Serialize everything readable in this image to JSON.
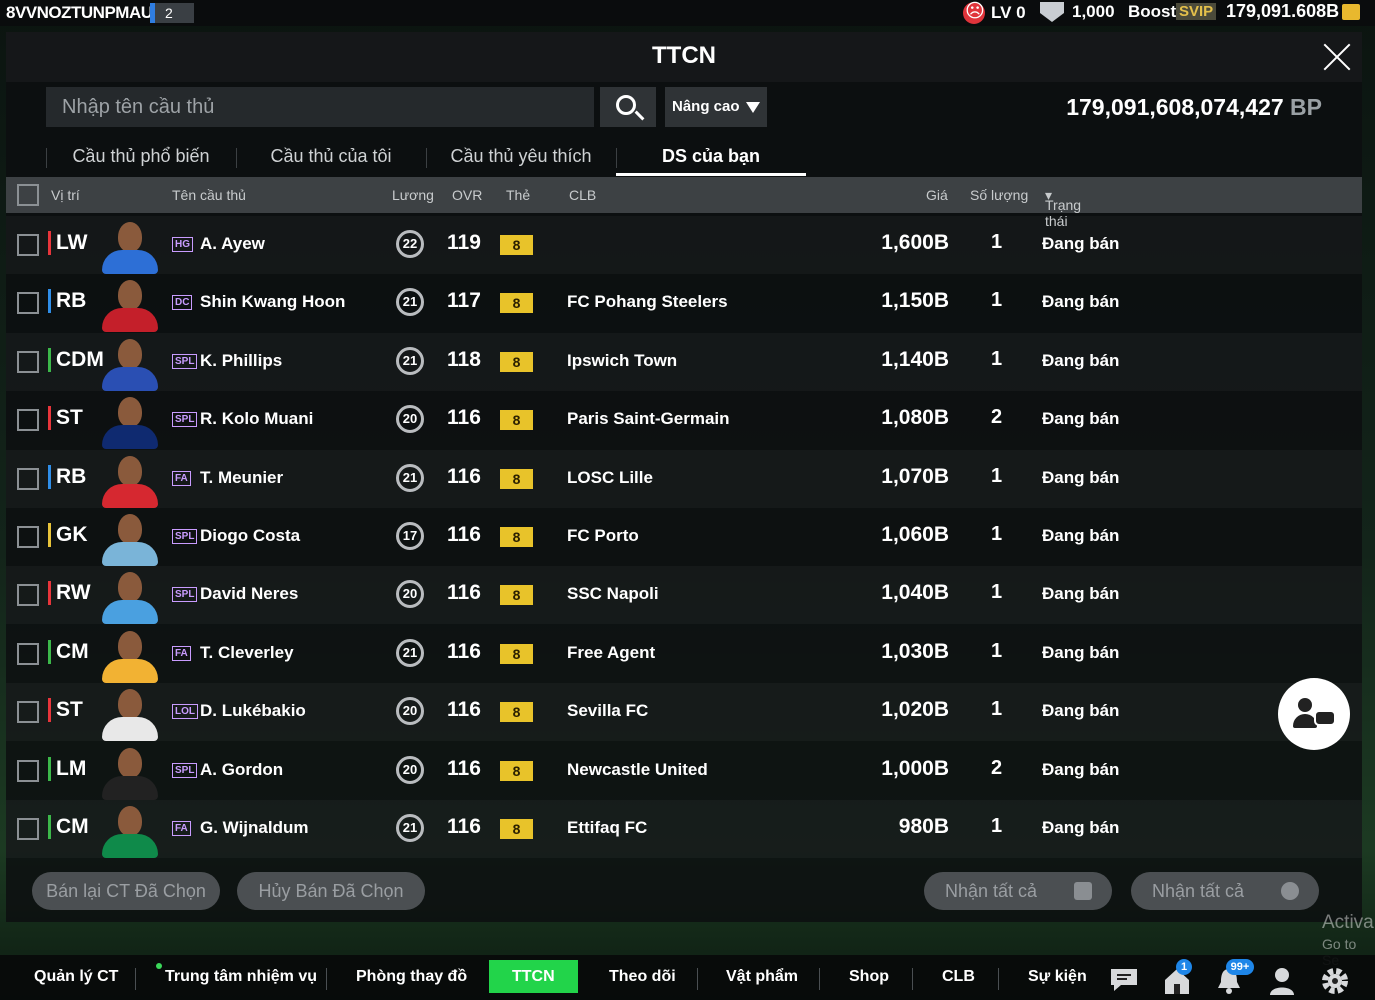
{
  "top_bar": {
    "account": "8VVNOZTUNPMAU",
    "account_badge": "2",
    "level": "LV 0",
    "coins": "1,000",
    "boost": "Boost",
    "svip": "SVIP",
    "bp": "179,091.608B"
  },
  "window": {
    "title": "TTCN"
  },
  "search": {
    "placeholder": "Nhập tên cầu thủ",
    "advanced": "Nâng cao",
    "bp_total_value": "179,091,608,074,427",
    "bp_total_unit": " BP"
  },
  "tabs": [
    "Cầu thủ phổ biến",
    "Cầu thủ của tôi",
    "Cầu thủ yêu thích",
    "DS của bạn"
  ],
  "columns": {
    "position": "Vị trí",
    "name": "Tên cầu thủ",
    "salary": "Lương",
    "ovr": "OVR",
    "card": "Thẻ",
    "club": "CLB",
    "price": "Giá",
    "quantity": "Số lượng",
    "status": "Trạng thái"
  },
  "rows": [
    {
      "pos": "LW",
      "season": "HG",
      "name": "A. Ayew",
      "salary": "22",
      "ovr": "119",
      "card": "8",
      "club": "",
      "price": "1,600B",
      "qty": "1",
      "status": "Đang bán"
    },
    {
      "pos": "RB",
      "season": "DC",
      "name": "Shin Kwang Hoon",
      "salary": "21",
      "ovr": "117",
      "card": "8",
      "club": "FC Pohang Steelers",
      "price": "1,150B",
      "qty": "1",
      "status": "Đang bán"
    },
    {
      "pos": "CDM",
      "season": "SPL",
      "name": "K. Phillips",
      "salary": "21",
      "ovr": "118",
      "card": "8",
      "club": "Ipswich Town",
      "price": "1,140B",
      "qty": "1",
      "status": "Đang bán"
    },
    {
      "pos": "ST",
      "season": "SPL",
      "name": "R. Kolo Muani",
      "salary": "20",
      "ovr": "116",
      "card": "8",
      "club": "Paris Saint-Germain",
      "price": "1,080B",
      "qty": "2",
      "status": "Đang bán"
    },
    {
      "pos": "RB",
      "season": "FA",
      "name": "T. Meunier",
      "salary": "21",
      "ovr": "116",
      "card": "8",
      "club": "LOSC Lille",
      "price": "1,070B",
      "qty": "1",
      "status": "Đang bán"
    },
    {
      "pos": "GK",
      "season": "SPL",
      "name": "Diogo Costa",
      "salary": "17",
      "ovr": "116",
      "card": "8",
      "club": "FC Porto",
      "price": "1,060B",
      "qty": "1",
      "status": "Đang bán"
    },
    {
      "pos": "RW",
      "season": "SPL",
      "name": "David Neres",
      "salary": "20",
      "ovr": "116",
      "card": "8",
      "club": "SSC Napoli",
      "price": "1,040B",
      "qty": "1",
      "status": "Đang bán"
    },
    {
      "pos": "CM",
      "season": "FA",
      "name": "T. Cleverley",
      "salary": "21",
      "ovr": "116",
      "card": "8",
      "club": "Free Agent",
      "price": "1,030B",
      "qty": "1",
      "status": "Đang bán"
    },
    {
      "pos": "ST",
      "season": "LOL",
      "name": "D. Lukébakio",
      "salary": "20",
      "ovr": "116",
      "card": "8",
      "club": "Sevilla FC",
      "price": "1,020B",
      "qty": "1",
      "status": "Đang bán"
    },
    {
      "pos": "LM",
      "season": "SPL",
      "name": "A. Gordon",
      "salary": "20",
      "ovr": "116",
      "card": "8",
      "club": "Newcastle United",
      "price": "1,000B",
      "qty": "2",
      "status": "Đang bán"
    },
    {
      "pos": "CM",
      "season": "FA",
      "name": "G. Wijnaldum",
      "salary": "21",
      "ovr": "116",
      "card": "8",
      "club": "Ettifaq FC",
      "price": "980B",
      "qty": "1",
      "status": "Đang bán"
    }
  ],
  "actions": {
    "resell": "Bán lại CT Đã Chọn",
    "cancel": "Hủy Bán Đã Chọn",
    "claim_all_1": "Nhận tất cả",
    "claim_all_2": "Nhận tất cả"
  },
  "watermark": {
    "line1": "Activa",
    "line2": "Go to Se"
  },
  "bottom_nav": {
    "manage": "Quản lý CT",
    "missions": "Trung tâm nhiệm vụ",
    "locker": "Phòng thay đồ",
    "market": "TTCN",
    "follow": "Theo dõi",
    "items": "Vật phẩm",
    "shop": "Shop",
    "club": "CLB",
    "events": "Sự kiện",
    "home_badge": "1",
    "notif_badge": "99+"
  }
}
